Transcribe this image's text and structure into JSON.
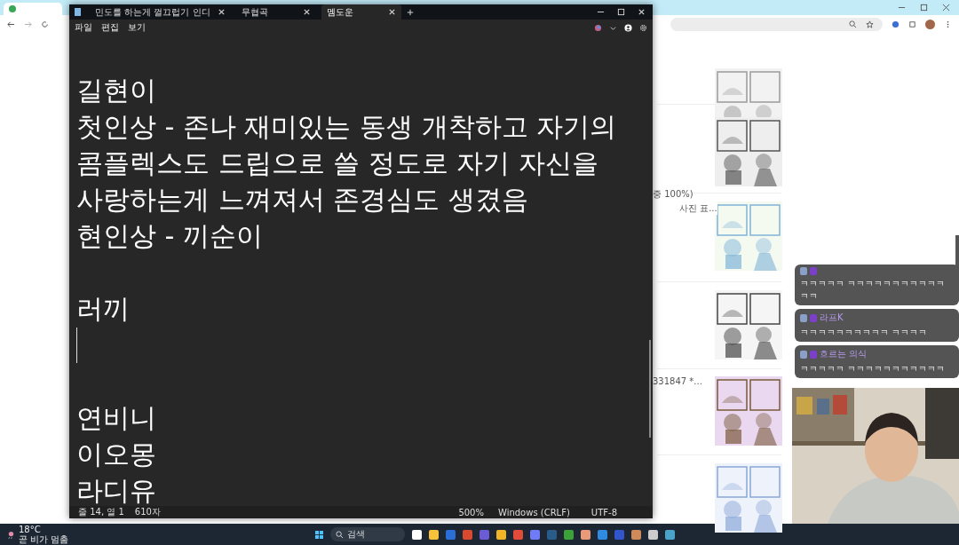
{
  "browser": {
    "snippets": [
      "중 100%)",
      "사진 표...",
      "331847 *..."
    ]
  },
  "notepad": {
    "tabs": [
      {
        "title": "민도를 하는게 껄끄럽기 인디",
        "selected": false
      },
      {
        "title": "무협곡",
        "selected": false
      },
      {
        "title": "멤도운",
        "selected": true
      }
    ],
    "menu": [
      "파일",
      "편집",
      "보기"
    ],
    "groups": [
      {
        "lines": [
          "길현이",
          "첫인상 - 존나 재미있는 동생 개착하고 자기의",
          "콤플렉스도 드립으로 쓸 정도로 자기 자신을",
          "사랑하는게 느껴져서 존경심도 생겼음",
          "현인상 - 끼순이"
        ],
        "caret": false
      },
      {
        "lines": [
          "러끼"
        ],
        "caret": true
      },
      {
        "lines": [
          "연비니",
          "이오몽",
          "라디유"
        ],
        "caret": false
      }
    ],
    "status": {
      "position": "줄 14, 열 1",
      "count": "610자",
      "zoom": "500%",
      "line_ending": "Windows (CRLF)",
      "encoding": "UTF-8"
    }
  },
  "chat": [
    {
      "text": "ㅋㅋㅋㅋㅋ ㅋㅋㅋㅋㅋㅋㅋㅋㅋㅋㅋㅋㅋ"
    },
    {
      "nickname": "라프K",
      "text": "ㅋㅋㅋㅋㅋㅋㅋㅋㅋㅋ ㅋㅋㅋㅋ"
    },
    {
      "nickname": "흐르는 의식",
      "text": "ㅋㅋㅋㅋㅋ ㅋㅋㅋㅋㅋㅋㅋㅋㅋㅋㅋ"
    }
  ],
  "taskbar": {
    "temperature": "18°C",
    "weather": "곧 비가 멈춤",
    "search": "검색"
  }
}
